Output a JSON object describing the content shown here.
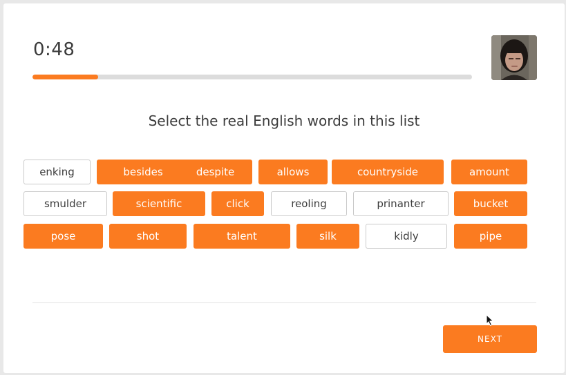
{
  "timer": "0:48",
  "progress": 0.15,
  "prompt": "Select the real English words in this list",
  "words": [
    {
      "text": "enking",
      "selected": false
    },
    {
      "text": "besides",
      "selected": true
    },
    {
      "text": "despite",
      "selected": true
    },
    {
      "text": "allows",
      "selected": true
    },
    {
      "text": "countryside",
      "selected": true
    },
    {
      "text": "amount",
      "selected": true
    },
    {
      "text": "smulder",
      "selected": false
    },
    {
      "text": "scientific",
      "selected": true
    },
    {
      "text": "click",
      "selected": true
    },
    {
      "text": "reoling",
      "selected": false
    },
    {
      "text": "prinanter",
      "selected": false
    },
    {
      "text": "bucket",
      "selected": true
    },
    {
      "text": "pose",
      "selected": true
    },
    {
      "text": "shot",
      "selected": true
    },
    {
      "text": "talent",
      "selected": true
    },
    {
      "text": "silk",
      "selected": true
    },
    {
      "text": "kidly",
      "selected": false
    },
    {
      "text": "pipe",
      "selected": true
    }
  ],
  "next_label": "NEXT",
  "colors": {
    "accent": "#fb7b20",
    "text": "#3c3c3c",
    "track": "#dcdcdc"
  },
  "icons": {
    "webcam": "webcam-preview-icon",
    "cursor": "mouse-pointer-icon"
  }
}
